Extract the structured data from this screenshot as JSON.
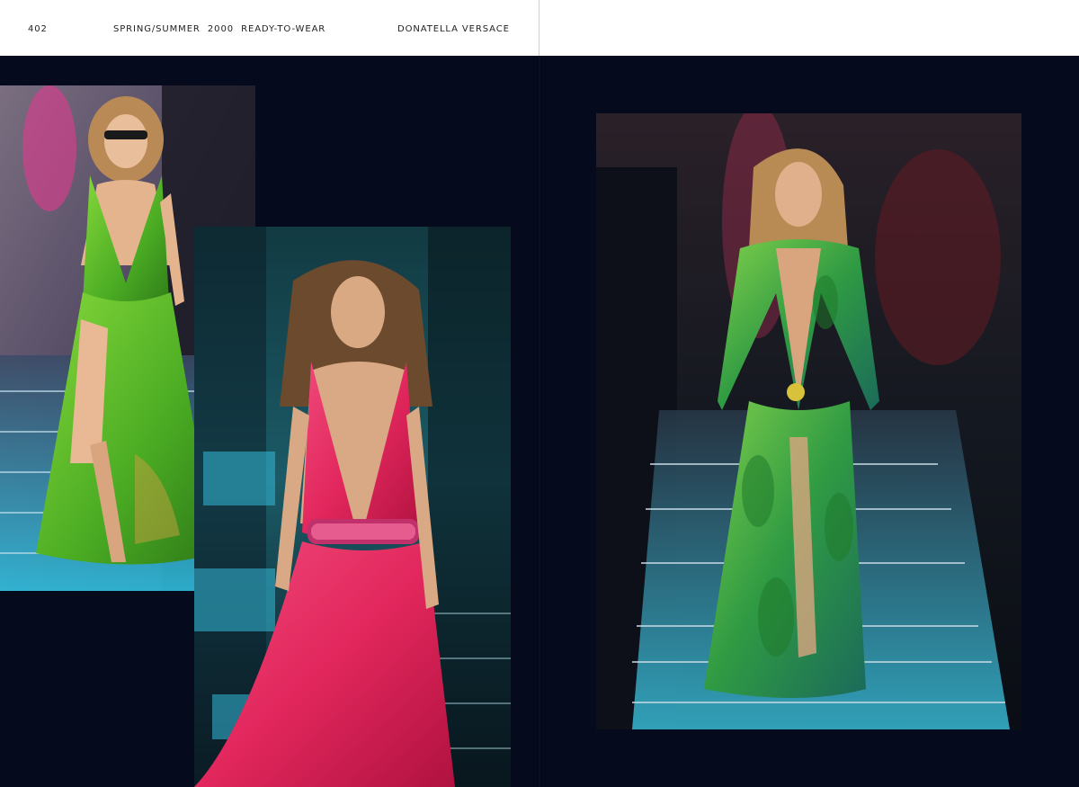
{
  "header": {
    "page_number": "402",
    "collection": "SPRING/SUMMER  2000  READY-TO-WEAR",
    "designer": "DONATELLA VERSACE"
  },
  "photos": [
    {
      "name": "green-halter-gown",
      "gown_color": "#56b82a"
    },
    {
      "name": "pink-chiffon-gown",
      "gown_color": "#e2275d"
    },
    {
      "name": "jungle-print-gown",
      "gown_color": "#2f9a43"
    }
  ],
  "colors": {
    "page_background": "#070b1e",
    "header_background": "#ffffff",
    "runway_glow": "#35b9d8"
  }
}
